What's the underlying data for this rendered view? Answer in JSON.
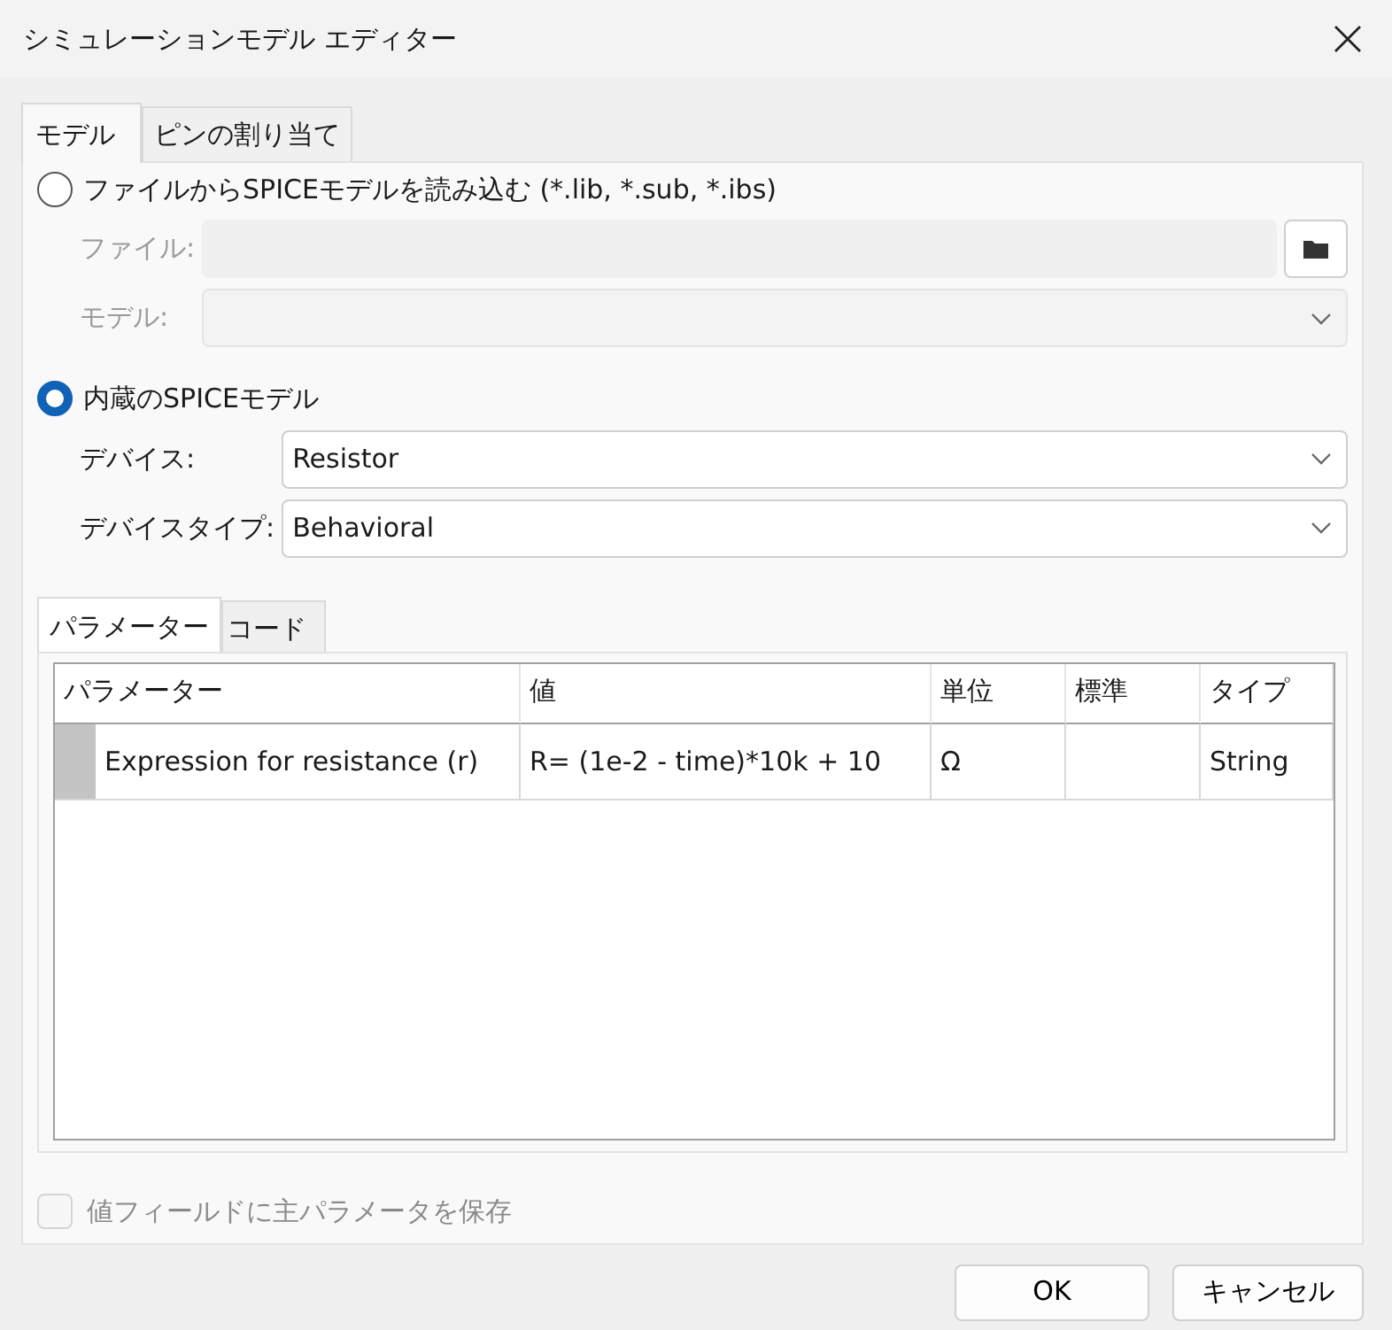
{
  "window": {
    "title": "シミュレーションモデル エディター"
  },
  "tabs": [
    {
      "label": "モデル",
      "selected": true
    },
    {
      "label": "ピンの割り当て",
      "selected": false
    }
  ],
  "source_options": [
    {
      "label": "ファイルからSPICEモデルを読み込む (*.lib, *.sub, *.ibs)",
      "selected": false,
      "fields": [
        {
          "label": "ファイル:",
          "kind": "path",
          "disabled": true
        },
        {
          "label": "モデル:",
          "kind": "select",
          "disabled": true
        }
      ]
    },
    {
      "label": "内蔵のSPICEモデル",
      "selected": true,
      "fields": [
        {
          "label": "デバイス:",
          "kind": "select",
          "value": "Resistor",
          "disabled": false
        },
        {
          "label": "デバイスタイプ:",
          "kind": "select",
          "value": "Behavioral",
          "disabled": false
        }
      ]
    }
  ],
  "sub_tabs": [
    {
      "label": "パラメーター",
      "selected": true
    },
    {
      "label": "コード",
      "selected": false
    }
  ],
  "parameter_table": {
    "columns": [
      "パラメーター",
      "値",
      "単位",
      "標準",
      "タイプ"
    ],
    "rows": [
      {
        "cells": [
          "Expression for resistance (r)",
          "R= (1e-2 - time)*10k + 10",
          "Ω",
          "",
          "String"
        ]
      }
    ]
  },
  "save_option": {
    "label": "値フィールドに主パラメータを保存",
    "checked": false,
    "disabled": true
  },
  "buttons": [
    "OK",
    "キャンセル"
  ]
}
